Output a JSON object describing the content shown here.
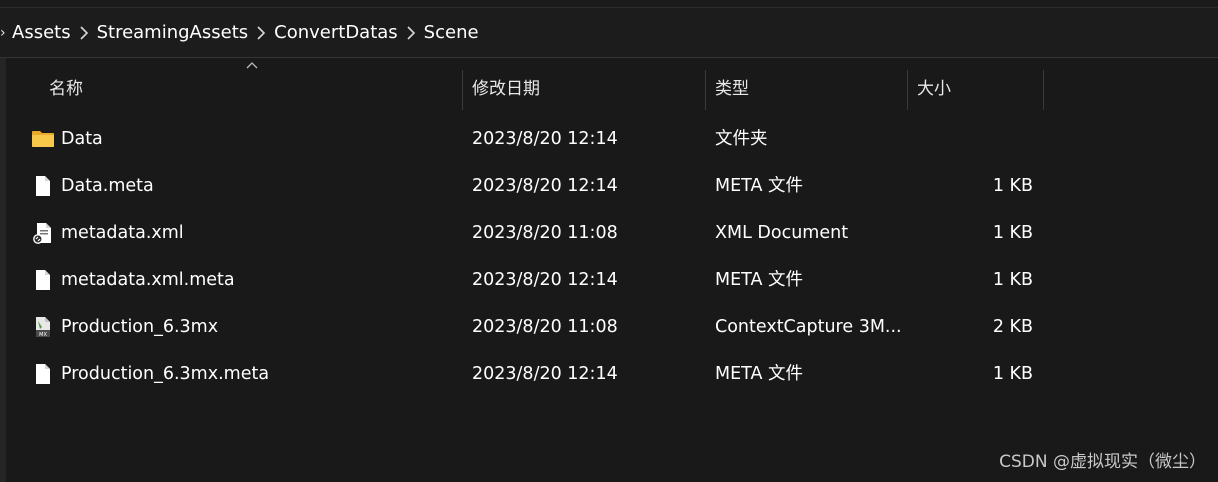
{
  "breadcrumb": {
    "items": [
      "Assets",
      "StreamingAssets",
      "ConvertDatas",
      "Scene"
    ]
  },
  "columns": {
    "name": "名称",
    "date": "修改日期",
    "type": "类型",
    "size": "大小"
  },
  "files": [
    {
      "icon": "folder-icon",
      "name": "Data",
      "date": "2023/8/20 12:14",
      "type": "文件夹",
      "size": ""
    },
    {
      "icon": "file-icon",
      "name": "Data.meta",
      "date": "2023/8/20 12:14",
      "type": "META 文件",
      "size": "1 KB"
    },
    {
      "icon": "xml-file-icon",
      "name": "metadata.xml",
      "date": "2023/8/20 11:08",
      "type": "XML Document",
      "size": "1 KB"
    },
    {
      "icon": "file-icon",
      "name": "metadata.xml.meta",
      "date": "2023/8/20 12:14",
      "type": "META 文件",
      "size": "1 KB"
    },
    {
      "icon": "3mx-file-icon",
      "name": "Production_6.3mx",
      "date": "2023/8/20 11:08",
      "type": "ContextCapture 3M...",
      "size": "2 KB"
    },
    {
      "icon": "file-icon",
      "name": "Production_6.3mx.meta",
      "date": "2023/8/20 12:14",
      "type": "META 文件",
      "size": "1 KB"
    }
  ],
  "watermark": "CSDN @虚拟现实（微尘）",
  "colors": {
    "background": "#191919",
    "folder": "#f6c244",
    "text": "#ffffff"
  }
}
